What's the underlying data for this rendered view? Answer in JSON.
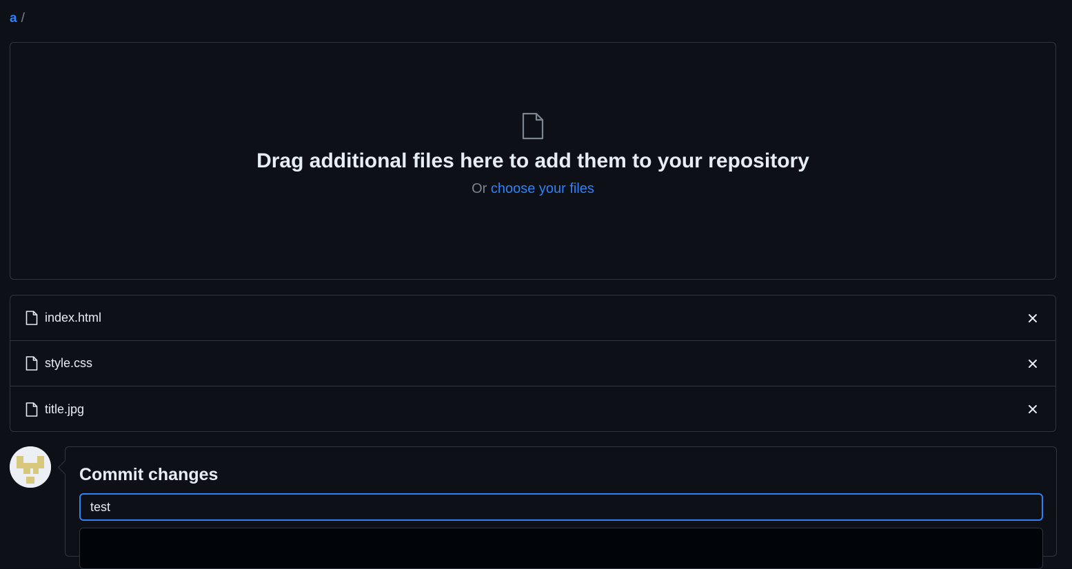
{
  "breadcrumb": {
    "repo": "a",
    "separator": "/"
  },
  "dropzone": {
    "title": "Drag additional files here to add them to your repository",
    "sub_prefix": "Or",
    "choose_link": "choose your files"
  },
  "files": [
    {
      "name": "index.html"
    },
    {
      "name": "style.css"
    },
    {
      "name": "title.jpg"
    }
  ],
  "commit": {
    "title": "Commit changes",
    "message_value": "test"
  },
  "colors": {
    "background": "#0d1117",
    "border": "#30363d",
    "accent": "#2f81f7",
    "text": "#e6edf3",
    "muted": "#7d8590"
  }
}
